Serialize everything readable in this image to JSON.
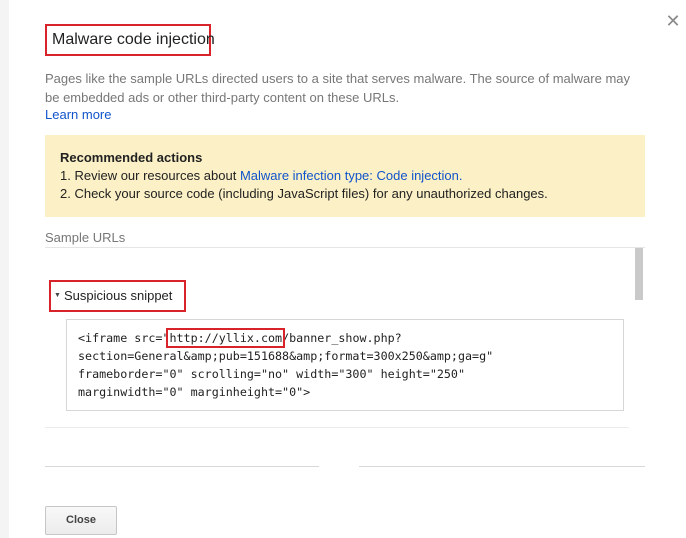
{
  "dialog": {
    "title": "Malware code injection",
    "description": "Pages like the sample URLs directed users to a site that serves malware. The source of malware may be embedded ads or other third-party content on these URLs.",
    "learn_more": "Learn more",
    "close_icon": "close-icon"
  },
  "recommended": {
    "heading": "Recommended actions",
    "item1_prefix": "1. Review our resources about ",
    "item1_link": "Malware infection type: Code injection.",
    "item2": "2. Check your source code (including JavaScript files) for any unauthorized changes."
  },
  "samples": {
    "label": "Sample URLs"
  },
  "snippet": {
    "heading": "Suspicious snippet",
    "code_before": "<iframe src=\"",
    "code_url": "http://yllix.com",
    "code_after": "/banner_show.php?\nsection=General&amp;pub=151688&amp;format=300x250&amp;ga=g\"\nframeborder=\"0\" scrolling=\"no\" width=\"300\" height=\"250\"\nmarginwidth=\"0\" marginheight=\"0\">"
  },
  "footer": {
    "close_label": "Close"
  },
  "colors": {
    "highlight_border": "#d9232b",
    "link": "#1155cc",
    "notice_bg": "#fbf0c6"
  }
}
